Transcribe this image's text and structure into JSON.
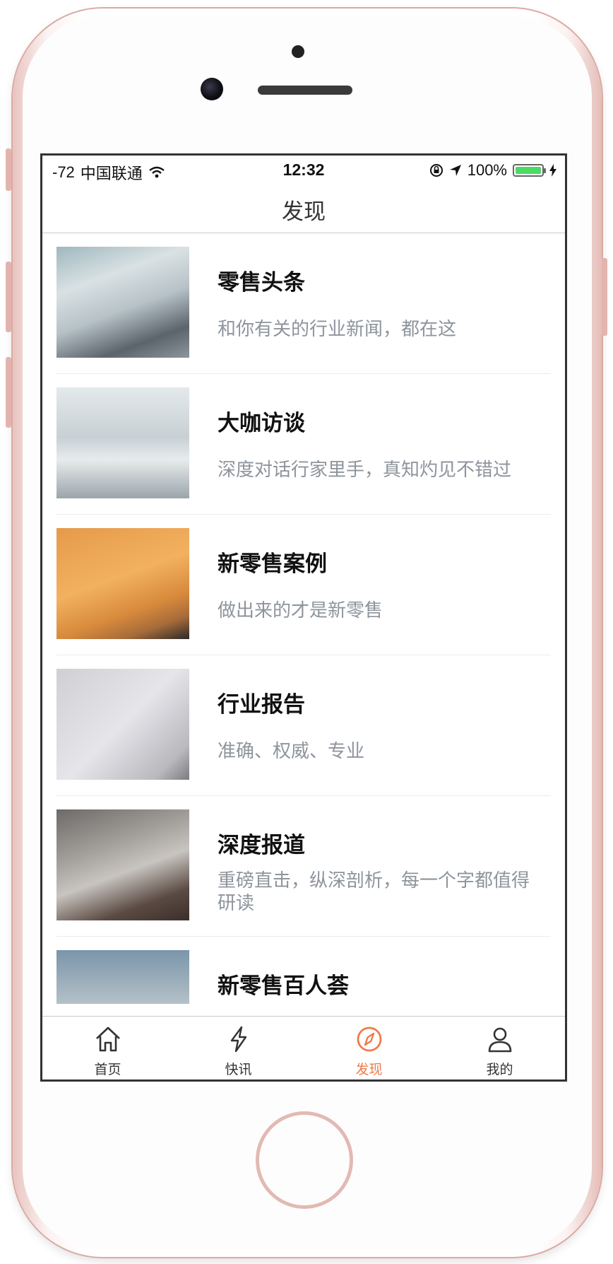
{
  "status_bar": {
    "signal": "-72",
    "carrier": "中国联通",
    "time": "12:32",
    "battery": "100%",
    "battery_color": "#4cd964"
  },
  "navbar": {
    "title": "发现"
  },
  "items": [
    {
      "title": "零售头条",
      "desc": "和你有关的行业新闻，都在这"
    },
    {
      "title": "大咖访谈",
      "desc": "深度对话行家里手，真知灼见不错过"
    },
    {
      "title": "新零售案例",
      "desc": "做出来的才是新零售"
    },
    {
      "title": "行业报告",
      "desc": "准确、权威、专业"
    },
    {
      "title": "深度报道",
      "desc": "重磅直击，纵深剖析，每一个字都值得研读"
    },
    {
      "title": "新零售百人荟",
      "desc": ""
    }
  ],
  "tabbar": {
    "tabs": [
      {
        "label": "首页",
        "icon": "home-icon"
      },
      {
        "label": "快讯",
        "icon": "lightning-icon"
      },
      {
        "label": "发现",
        "icon": "compass-icon",
        "active": true
      },
      {
        "label": "我的",
        "icon": "user-icon"
      }
    ],
    "active_color": "#f07a4a"
  }
}
